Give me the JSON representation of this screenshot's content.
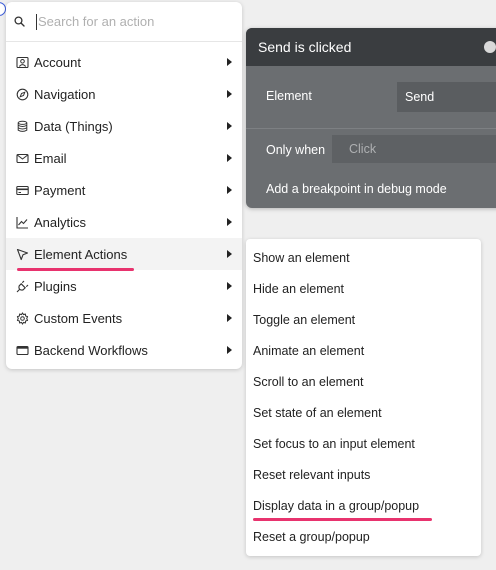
{
  "search": {
    "placeholder": "Search for an action"
  },
  "menu": {
    "items": [
      {
        "label": "Account",
        "icon": "account-icon"
      },
      {
        "label": "Navigation",
        "icon": "compass-icon"
      },
      {
        "label": "Data (Things)",
        "icon": "database-icon"
      },
      {
        "label": "Email",
        "icon": "envelope-icon"
      },
      {
        "label": "Payment",
        "icon": "credit-card-icon"
      },
      {
        "label": "Analytics",
        "icon": "chart-line-icon"
      },
      {
        "label": "Element Actions",
        "icon": "cursor-pointer-icon",
        "active": true
      },
      {
        "label": "Plugins",
        "icon": "plug-icon"
      },
      {
        "label": "Custom Events",
        "icon": "gear-icon"
      },
      {
        "label": "Backend Workflows",
        "icon": "window-icon"
      }
    ]
  },
  "workflow": {
    "title": "Send is clicked",
    "element_label": "Element",
    "element_value": "Send",
    "only_when_label": "Only when",
    "only_when_value": "Click",
    "breakpoint_label": "Add a breakpoint in debug mode"
  },
  "submenu": {
    "items": [
      "Show an element",
      "Hide an element",
      "Toggle an element",
      "Animate an element",
      "Scroll to an element",
      "Set state of an element",
      "Set focus to an input element",
      "Reset relevant inputs",
      "Display data in a group/popup",
      "Reset a group/popup"
    ]
  },
  "colors": {
    "highlight": "#e8336e",
    "card_header": "#3a3d40",
    "card_body": "#6b6e71"
  }
}
